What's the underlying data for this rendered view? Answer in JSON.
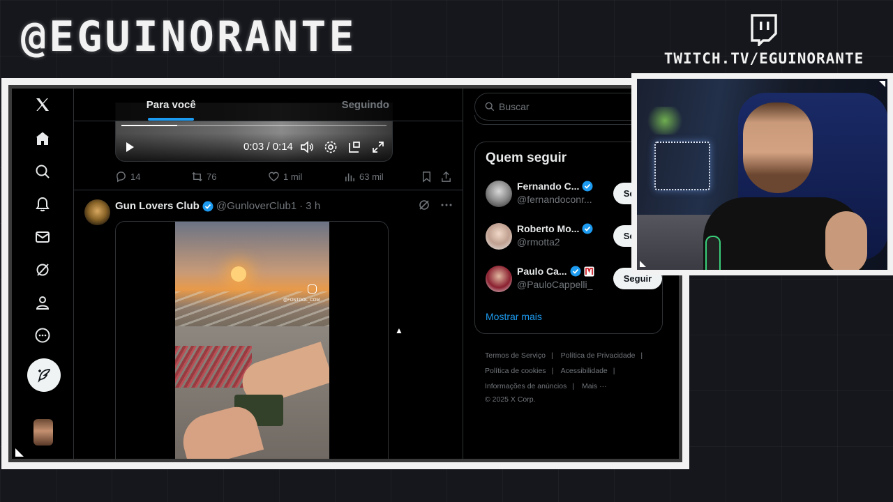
{
  "overlay": {
    "handle": "@EGUINORANTE",
    "twitch_url": "TWITCH.TV/EGUINORANTE"
  },
  "nav": {
    "items": [
      "x-logo",
      "home-icon",
      "search-icon",
      "notifications-icon",
      "messages-icon",
      "grok-icon",
      "profile-icon",
      "more-icon"
    ],
    "post_icon": "feather-icon"
  },
  "timeline": {
    "tabs": [
      {
        "label": "Para você",
        "active": true
      },
      {
        "label": "Seguindo",
        "active": false
      }
    ],
    "video": {
      "time": "0:03 / 0:14",
      "progress": 0.21
    },
    "actions": {
      "replies": "14",
      "reposts": "76",
      "likes": "1 mil",
      "views": "63 mil"
    },
    "post": {
      "name": "Gun Lovers Club",
      "handle": "@GunloverClub1",
      "time": "· 3 h",
      "media_watermark": "@FONTOOL_COM"
    }
  },
  "sidebar": {
    "search_placeholder": "Buscar",
    "who_to_follow": {
      "title": "Quem seguir",
      "items": [
        {
          "name": "Fernando C...",
          "handle": "@fernandoconr...",
          "button": "Seguir"
        },
        {
          "name": "Roberto Mo...",
          "handle": "@rmotta2",
          "button": "Seguir"
        },
        {
          "name": "Paulo Ca...",
          "handle": "@PauloCappelli_",
          "button": "Seguir"
        }
      ],
      "show_more": "Mostrar mais"
    },
    "footer": {
      "links": [
        "Termos de Serviço",
        "Política de Privacidade",
        "Política de cookies",
        "Acessibilidade",
        "Informações de anúncios",
        "Mais ···"
      ],
      "copyright": "© 2025 X Corp."
    }
  },
  "colors": {
    "accent": "#1d9bf0",
    "background": "#000000",
    "border": "#2f3336",
    "muted_text": "#71767b"
  }
}
